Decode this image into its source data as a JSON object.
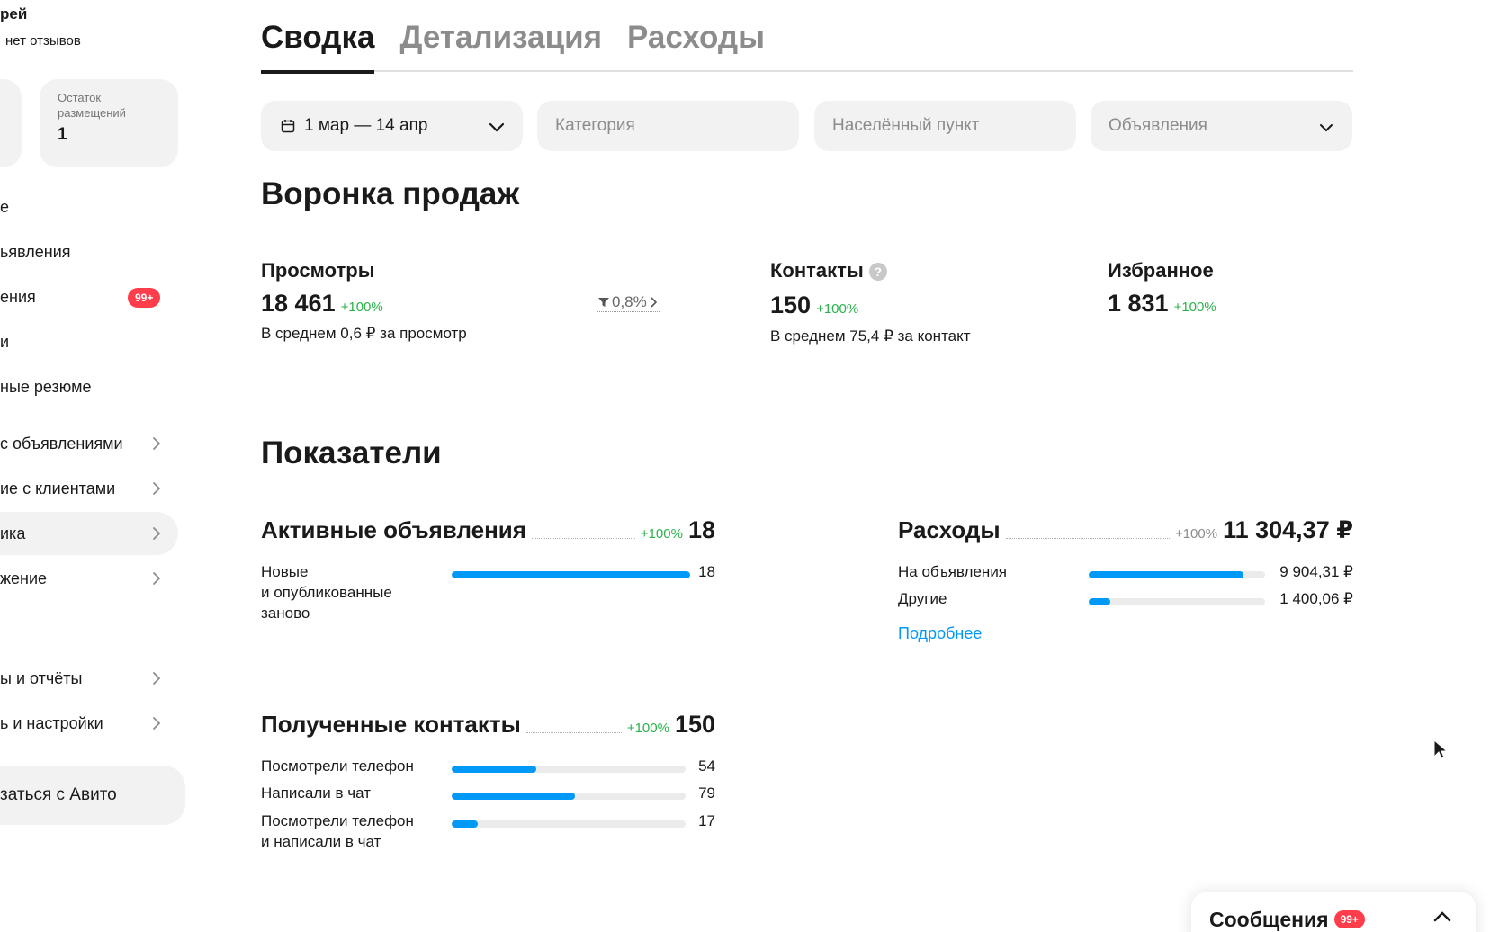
{
  "sidebar": {
    "user_name": "рей",
    "user_reviews": "нет отзывов",
    "stat_label": "Остаток размещений",
    "stat_value": "1",
    "items": [
      {
        "label": "е"
      },
      {
        "label": "ьявления"
      },
      {
        "label": "ения",
        "badge": "99+"
      },
      {
        "label": "и"
      },
      {
        "label": "ные резюме"
      },
      {
        "label": "с объявлениями"
      },
      {
        "label": "ие с клиентами"
      },
      {
        "label": "ика"
      },
      {
        "label": "жение"
      },
      {
        "label": "ы и отчёты"
      },
      {
        "label": "ь и настройки"
      }
    ],
    "help_label": "заться с Авито"
  },
  "tabs": [
    {
      "label": "Сводка",
      "active": true
    },
    {
      "label": "Детализация",
      "active": false
    },
    {
      "label": "Расходы",
      "active": false
    }
  ],
  "filters": {
    "date": "1 мар — 14 апр",
    "category_placeholder": "Категория",
    "location_placeholder": "Населённый пункт",
    "ads_placeholder": "Объявления"
  },
  "funnel": {
    "title": "Воронка продаж",
    "views": {
      "title": "Просмотры",
      "value": "18 461",
      "delta": "+100%",
      "sub": "В среднем 0,6 ₽ за просмотр",
      "conversion": "0,8%"
    },
    "contacts": {
      "title": "Контакты",
      "help": "?",
      "value": "150",
      "delta": "+100%",
      "sub": "В среднем 75,4 ₽ за контакт"
    },
    "favorites": {
      "title": "Избранное",
      "value": "1 831",
      "delta": "+100%"
    }
  },
  "indicators": {
    "title": "Показатели",
    "active_ads": {
      "title": "Активные объявления",
      "delta": "+100%",
      "value": "18",
      "rows": [
        {
          "label": "Новые\nи опубликованные\nзаново",
          "value": "18",
          "fill": 1.0
        }
      ]
    },
    "expenses": {
      "title": "Расходы",
      "delta": "+100%",
      "value": "11 304,37 ₽",
      "rows": [
        {
          "label": "На объявления",
          "value": "9 904,31 ₽",
          "fill": 0.876
        },
        {
          "label": "Другие",
          "value": "1 400,06 ₽",
          "fill": 0.124
        }
      ],
      "more_link": "Подробнее"
    },
    "contacts": {
      "title": "Полученные контакты",
      "delta": "+100%",
      "value": "150",
      "rows": [
        {
          "label": "Посмотрели телефон",
          "value": "54",
          "fill": 0.36
        },
        {
          "label": "Написали в чат",
          "value": "79",
          "fill": 0.527
        },
        {
          "label": "Посмотрели телефон\nи написали в чат",
          "value": "17",
          "fill": 0.113
        }
      ]
    }
  },
  "messages": {
    "title": "Сообщения",
    "badge": "99+"
  },
  "colors": {
    "accent": "#0099f7",
    "positive": "#2bb24c",
    "badge": "#ff3d4b",
    "panel": "#f2f2f2"
  }
}
